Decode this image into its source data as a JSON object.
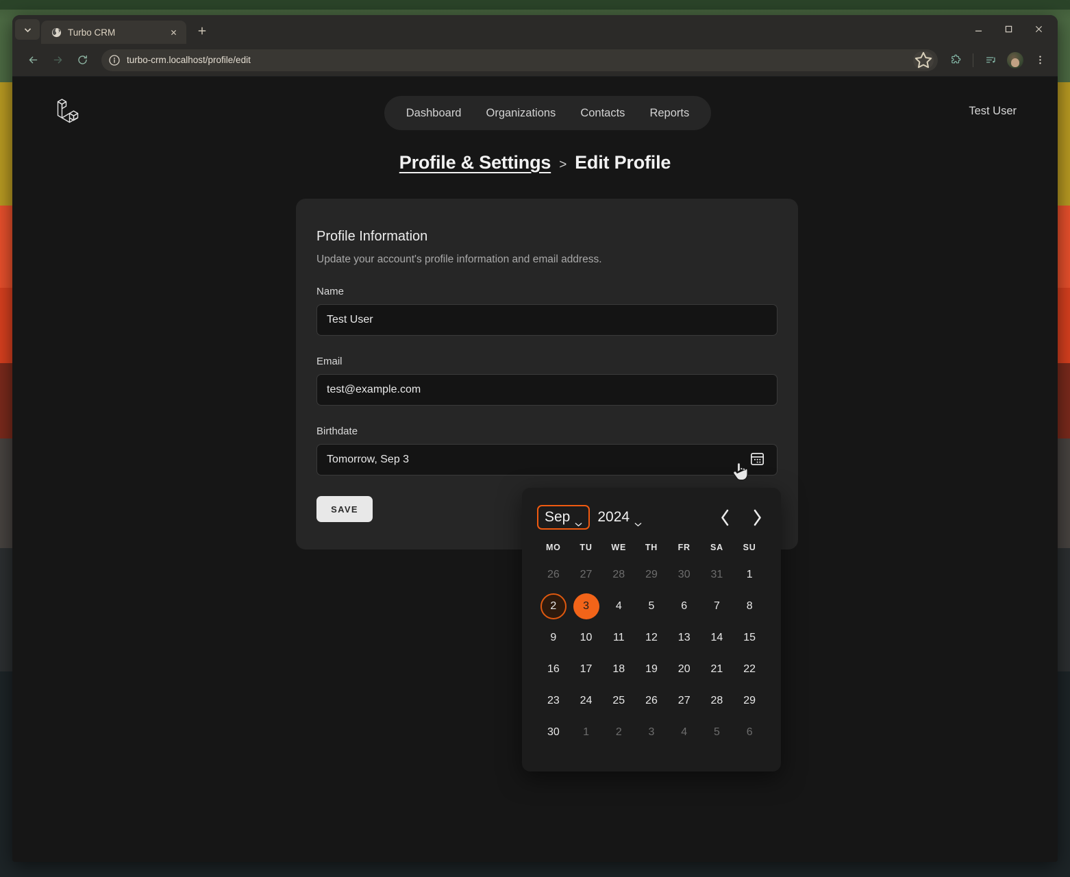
{
  "browser": {
    "tab_list_icon": "chevron-down-icon",
    "tab": {
      "title": "Turbo CRM",
      "favicon": "globe-icon",
      "close_icon": "close-icon"
    },
    "new_tab_label": "+",
    "window_controls": {
      "minimize": "minimize-icon",
      "maximize": "maximize-icon",
      "close": "close-icon"
    },
    "toolbar": {
      "back_icon": "back-arrow-icon",
      "forward_icon": "forward-arrow-icon",
      "reload_icon": "reload-icon",
      "site_info_icon": "info-circle-icon",
      "url": "turbo-crm.localhost/profile/edit",
      "bookmark_icon": "star-icon",
      "extensions_icon": "puzzle-piece-icon",
      "media_icon": "media-playlist-icon",
      "avatar_icon": "user-avatar",
      "menu_icon": "three-dot-menu-icon"
    }
  },
  "app": {
    "logo": "laravel-logo",
    "nav": [
      {
        "label": "Dashboard"
      },
      {
        "label": "Organizations"
      },
      {
        "label": "Contacts"
      },
      {
        "label": "Reports"
      }
    ],
    "user": "Test User"
  },
  "breadcrumb": {
    "parent": "Profile & Settings",
    "separator": ">",
    "current": "Edit Profile"
  },
  "card": {
    "title": "Profile Information",
    "subtitle": "Update your account's profile information and email address.",
    "fields": {
      "name": {
        "label": "Name",
        "value": "Test User",
        "placeholder": "Name"
      },
      "email": {
        "label": "Email",
        "value": "test@example.com",
        "placeholder": "Email"
      },
      "birthdate": {
        "label": "Birthdate",
        "value": "Tomorrow, Sep 3",
        "placeholder": "Birthdate",
        "icon": "calendar-icon"
      }
    },
    "save_label": "SAVE"
  },
  "datepicker": {
    "month": "Sep",
    "year": "2024",
    "prev_icon": "chevron-left-icon",
    "next_icon": "chevron-right-icon",
    "weekdays": [
      "MO",
      "TU",
      "WE",
      "TH",
      "FR",
      "SA",
      "SU"
    ],
    "weeks": [
      [
        {
          "d": "26",
          "state": "muted"
        },
        {
          "d": "27",
          "state": "muted"
        },
        {
          "d": "28",
          "state": "muted"
        },
        {
          "d": "29",
          "state": "muted"
        },
        {
          "d": "30",
          "state": "muted"
        },
        {
          "d": "31",
          "state": "muted"
        },
        {
          "d": "1",
          "state": "normal"
        }
      ],
      [
        {
          "d": "2",
          "state": "today"
        },
        {
          "d": "3",
          "state": "selected"
        },
        {
          "d": "4",
          "state": "normal"
        },
        {
          "d": "5",
          "state": "normal"
        },
        {
          "d": "6",
          "state": "normal"
        },
        {
          "d": "7",
          "state": "normal"
        },
        {
          "d": "8",
          "state": "normal"
        }
      ],
      [
        {
          "d": "9",
          "state": "normal"
        },
        {
          "d": "10",
          "state": "normal"
        },
        {
          "d": "11",
          "state": "normal"
        },
        {
          "d": "12",
          "state": "normal"
        },
        {
          "d": "13",
          "state": "normal"
        },
        {
          "d": "14",
          "state": "normal"
        },
        {
          "d": "15",
          "state": "normal"
        }
      ],
      [
        {
          "d": "16",
          "state": "normal"
        },
        {
          "d": "17",
          "state": "normal"
        },
        {
          "d": "18",
          "state": "normal"
        },
        {
          "d": "19",
          "state": "normal"
        },
        {
          "d": "20",
          "state": "normal"
        },
        {
          "d": "21",
          "state": "normal"
        },
        {
          "d": "22",
          "state": "normal"
        }
      ],
      [
        {
          "d": "23",
          "state": "normal"
        },
        {
          "d": "24",
          "state": "normal"
        },
        {
          "d": "25",
          "state": "normal"
        },
        {
          "d": "26",
          "state": "normal"
        },
        {
          "d": "27",
          "state": "normal"
        },
        {
          "d": "28",
          "state": "normal"
        },
        {
          "d": "29",
          "state": "normal"
        }
      ],
      [
        {
          "d": "30",
          "state": "normal"
        },
        {
          "d": "1",
          "state": "muted"
        },
        {
          "d": "2",
          "state": "muted"
        },
        {
          "d": "3",
          "state": "muted"
        },
        {
          "d": "4",
          "state": "muted"
        },
        {
          "d": "5",
          "state": "muted"
        },
        {
          "d": "6",
          "state": "muted"
        }
      ]
    ]
  },
  "colors": {
    "accent": "#f26419",
    "accent_ring": "#e0590f",
    "page_bg": "#161616",
    "card_bg": "#262626",
    "input_bg": "#141414"
  }
}
